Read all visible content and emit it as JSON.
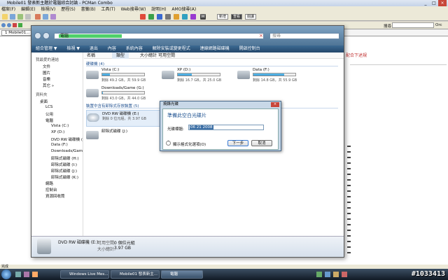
{
  "pcman": {
    "title": "Mobile01 發表新主題於電腦綜合討論 - PCMan Combo",
    "menu": [
      "檔案(F)",
      "編輯(E)",
      "檢視(V)",
      "歷程(S)",
      "書籤(B)",
      "工具(T)",
      "Web搜尋(W)",
      "說明(H)",
      "AMO搜尋(A)",
      "工具(T)",
      "說明(H)"
    ],
    "tab_label": "1 Mobile01...",
    "search_label": "搜尋",
    "search_value": "Orc",
    "toolbar_labels": [
      "新增",
      "查看",
      "閱讀"
    ],
    "status_text": "完成",
    "right_panel_text": "配合下述規"
  },
  "explorer": {
    "address": "電腦",
    "search_placeholder": "搜尋",
    "commands": [
      "組合管理 ▼",
      "檢視 ▼",
      "退出",
      "內容",
      "系統內容",
      "解除安裝或變更程式",
      "連線網路磁碟機",
      "開啟控制台"
    ],
    "nav": {
      "header": "我最愛的連結",
      "favorites": [
        "文件",
        "圖片",
        "音樂",
        "其它 »"
      ],
      "folders_label": "資料夾",
      "tree": [
        "桌面",
        "LCS",
        "公用",
        "電腦",
        "Vista (C:)",
        "XP (D:)",
        "DVD RW 磁碟機 (",
        "Data (F:)",
        "Downloads/Gam",
        "卸除式磁碟 (H:)",
        "卸除式磁碟 (I:)",
        "卸除式磁碟 (J:)",
        "卸除式磁碟 (K:)",
        "網路",
        "控制台",
        "資源回收筒"
      ]
    },
    "columns": [
      "名稱",
      "類型",
      "大小總計",
      "可用空間"
    ],
    "groups": {
      "hard_disks": "硬碟機 (4)",
      "removable": "裝置中含有卸除式存放裝置 (5)"
    },
    "drives": [
      {
        "name": "Vista (C:)",
        "free": "剩餘 49.2 GB，共 59.9 GB",
        "used": 0.18
      },
      {
        "name": "XP (D:)",
        "free": "剩餘 16.7 GB，共 25.0 GB",
        "used": 0.33
      },
      {
        "name": "Data (F:)",
        "free": "剩餘 14.8 GB，共 55.9 GB",
        "used": 0.74
      },
      {
        "name": "Downloads/Game (G:)",
        "free": "剩餘 43.0 GB，共 44.0 GB",
        "used": 0.02
      }
    ],
    "removable": [
      {
        "name": "DVD RW 磁碟機 (E:)",
        "free": "剩餘 0 位元組，共 3.97 GB"
      },
      {
        "name": "卸除式磁碟 (J:)",
        "free": ""
      }
    ],
    "details": {
      "name": "DVD RW 磁碟機 (E:)",
      "free_label": "可用空間:",
      "free_value": "0 個位元組",
      "total_label": "大小總計:",
      "total_value": "3.97 GB"
    }
  },
  "dialog": {
    "title": "燒錄光碟",
    "heading": "準備此空白光碟片",
    "label": "光碟標題:",
    "value": "06 21 2008",
    "options": "顯示格式化選項(O)",
    "next": "下一步",
    "cancel": "取消"
  },
  "taskbar": {
    "items": [
      "Windows Live Mes...",
      "Mobile01 發表新主...",
      "電腦"
    ]
  },
  "watermark": "#1033413"
}
